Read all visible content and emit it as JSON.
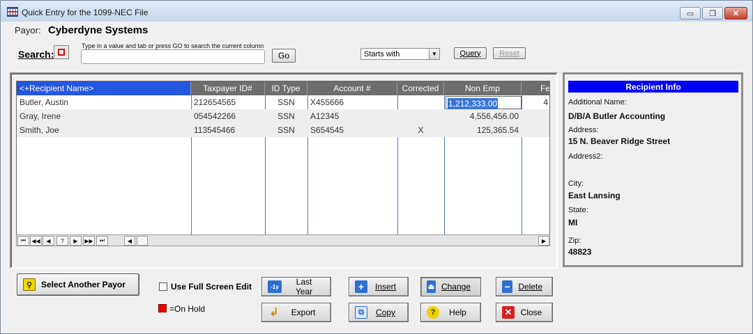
{
  "window": {
    "title": "Quick Entry for the 1099-NEC File",
    "min_glyph": "▭",
    "max_glyph": "❐",
    "close_glyph": "✕"
  },
  "payor": {
    "label": "Payor:",
    "name": "Cyberdyne Systems"
  },
  "search": {
    "label": "Search:",
    "hint": "Type in a value and tab or press GO to search the current column",
    "value": "",
    "go_label": "Go",
    "mode": "Starts with",
    "query_label": "Query",
    "reset_label": "Reset"
  },
  "grid": {
    "columns": [
      "<+Recipient Name>",
      "Taxpayer ID#",
      "ID Type",
      "Account #",
      "Corrected",
      "Non Emp",
      "Fe"
    ],
    "rows": [
      {
        "name": "Butler, Austin",
        "tin": "212654565",
        "id_type": "SSN",
        "account": "X455666",
        "corrected": "",
        "non_emp": "1,212,333.00",
        "fe": "4"
      },
      {
        "name": "Gray, Irene",
        "tin": "054542266",
        "id_type": "SSN",
        "account": "A12345",
        "corrected": "",
        "non_emp": "4,556,456.00",
        "fe": ""
      },
      {
        "name": "Smith, Joe",
        "tin": "113545466",
        "id_type": "SSN",
        "account": "S654545",
        "corrected": "X",
        "non_emp": "125,365.54",
        "fe": ""
      }
    ],
    "nav": [
      "⏮",
      "◀◀",
      "◀",
      "?",
      "▶",
      "▶▶",
      "⏭"
    ],
    "scroll_left": "◀",
    "scroll_right": "▶"
  },
  "recipient_info": {
    "title": "Recipient Info",
    "fields": [
      {
        "label": "Additional Name:",
        "value": "D/B/A Butler Accounting"
      },
      {
        "label": "Address:",
        "value": "15 N. Beaver Ridge Street"
      },
      {
        "label": "Address2:",
        "value": ""
      },
      {
        "label": "City:",
        "value": "East Lansing"
      },
      {
        "label": "State:",
        "value": "MI"
      },
      {
        "label": "Zip:",
        "value": "48823"
      }
    ]
  },
  "bottom": {
    "select_payor": "Select Another Payor",
    "full_screen_label": "Use Full Screen Edit",
    "on_hold_label": "=On Hold",
    "last_year_badge": "-1y",
    "buttons": {
      "last_year": "Last Year",
      "export": "Export",
      "insert": "Insert",
      "copy": "Copy",
      "change": "Change",
      "help": "Help",
      "delete": "Delete",
      "close": "Close"
    }
  },
  "colors": {
    "grid_header": "#6d6d6d",
    "grid_header_selected": "#2457e0",
    "info_title": "#0000ff",
    "on_hold": "#ee0000"
  }
}
